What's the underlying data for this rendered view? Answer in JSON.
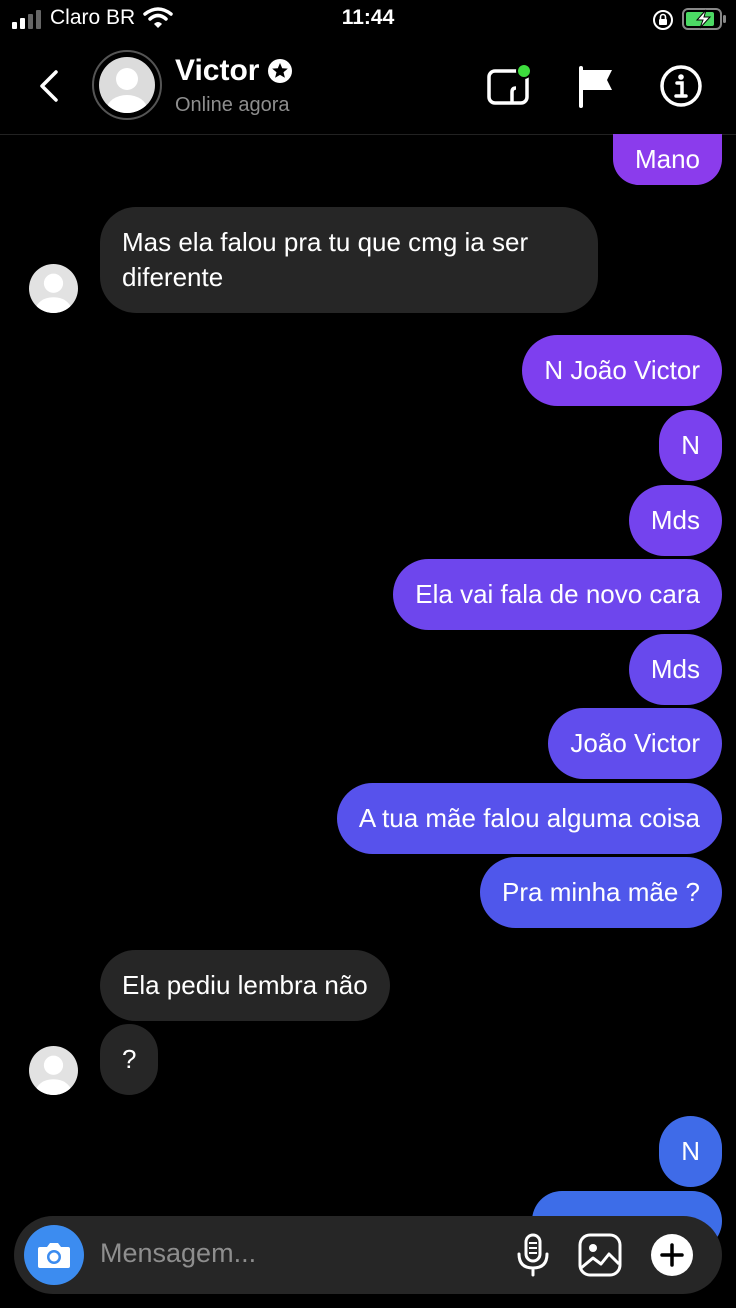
{
  "status_bar": {
    "carrier": "Claro BR",
    "time": "11:44"
  },
  "header": {
    "contact_name": "Victor",
    "status_text": "Online agora"
  },
  "messages": {
    "m0": "Mano",
    "m1": "Mas ela falou pra tu que cmg ia ser diferente",
    "m2": "N João Victor",
    "m3": "N",
    "m4": "Mds",
    "m5": "Ela vai fala de novo cara",
    "m6": "Mds",
    "m7": "João Victor",
    "m8": "A tua mãe falou alguma coisa",
    "m9": "Pra minha mãe ?",
    "m10": "Ela pediu lembra não",
    "m11": "?",
    "m12": "N"
  },
  "composer": {
    "placeholder": "Mensagem..."
  },
  "colors": {
    "sent_gradient_top": "#8a3ff0",
    "sent_gradient_bottom": "#3f6be8",
    "received": "#262626",
    "camera_button": "#3c8cf0",
    "online_dot": "#3ddc3d"
  },
  "icons": [
    "back-icon",
    "avatar",
    "verified-icon",
    "video-call-icon",
    "flag-icon",
    "info-icon",
    "camera-icon",
    "microphone-icon",
    "gallery-icon",
    "plus-icon"
  ]
}
